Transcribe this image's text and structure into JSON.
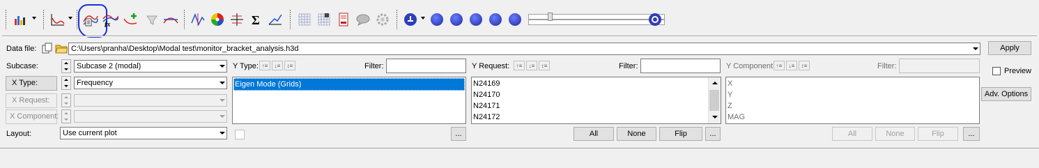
{
  "toolbar": {
    "icons": [
      "bar-chart-icon",
      "line-plot-icon",
      "curve-editor-icon",
      "fx-curve-icon",
      "add-curve-icon",
      "filter-curve-icon",
      "curve-icon",
      "peak-icon",
      "color-wheel-icon",
      "axis-icon",
      "sigma-icon",
      "trend-icon",
      "grid-icon",
      "table-grid-icon",
      "report-icon",
      "comment-icon",
      "settings-icon",
      "step-icon",
      "first-icon",
      "rewind-icon",
      "play-icon",
      "forward-icon",
      "last-icon",
      "animation-settings-icon"
    ]
  },
  "data_file": {
    "label": "Data file:",
    "path": "C:\\Users\\pranha\\Desktop\\Modal test\\monitor_bracket_analysis.h3d"
  },
  "apply_label": "Apply",
  "preview_label": "Preview",
  "adv_options_label": "Adv. Options",
  "subcase": {
    "label": "Subcase:",
    "value": "Subcase 2 (modal)"
  },
  "xtype": {
    "label": "X Type:",
    "value": "Frequency"
  },
  "xrequest": {
    "label": "X Request:",
    "value": ""
  },
  "xcomponent": {
    "label": "X Component:",
    "value": ""
  },
  "layout": {
    "label": "Layout:",
    "value": "Use current plot"
  },
  "ytype": {
    "label": "Y Type:",
    "filter_label": "Filter:",
    "filter_value": "",
    "items": [
      "Eigen Mode (Grids)"
    ]
  },
  "yrequest": {
    "label": "Y Request:",
    "filter_label": "Filter:",
    "filter_value": "",
    "items": [
      "N24169",
      "N24170",
      "N24171",
      "N24172"
    ],
    "all": "All",
    "none": "None",
    "flip": "Flip",
    "more": "..."
  },
  "ycomponent": {
    "label": "Y Component:",
    "filter_label": "Filter:",
    "filter_value": "",
    "items": [
      "X",
      "Y",
      "Z",
      "MAG"
    ],
    "all": "All",
    "none": "None",
    "flip": "Flip",
    "more": "..."
  },
  "ytype_more": "..."
}
